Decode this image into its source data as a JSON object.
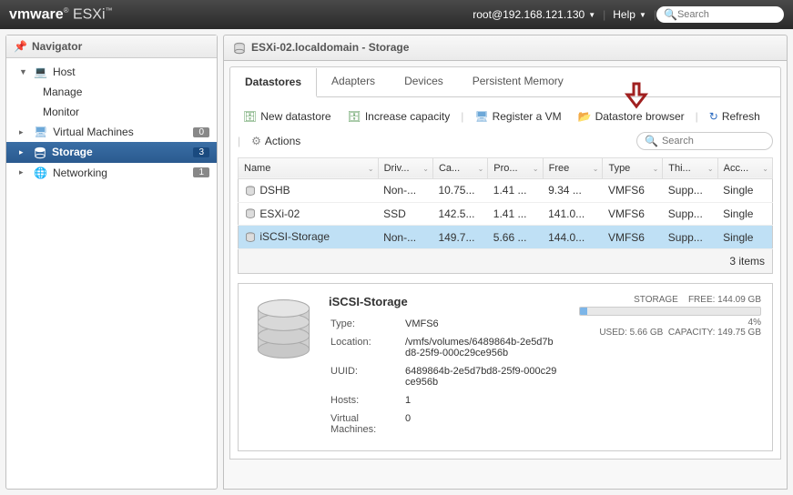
{
  "topbar": {
    "logo_vmware": "vmware",
    "logo_prod": "ESXi",
    "user": "root@192.168.121.130",
    "help": "Help",
    "search_placeholder": "Search"
  },
  "nav": {
    "title": "Navigator",
    "host": "Host",
    "manage": "Manage",
    "monitor": "Monitor",
    "vms": "Virtual Machines",
    "vms_badge": "0",
    "storage": "Storage",
    "storage_badge": "3",
    "networking": "Networking",
    "networking_badge": "1"
  },
  "header": {
    "title": "ESXi-02.localdomain - Storage"
  },
  "tabs": {
    "datastores": "Datastores",
    "adapters": "Adapters",
    "devices": "Devices",
    "pmem": "Persistent Memory"
  },
  "toolbar": {
    "new_ds": "New datastore",
    "increase": "Increase capacity",
    "register": "Register a VM",
    "browser": "Datastore browser",
    "refresh": "Refresh",
    "actions": "Actions",
    "search_placeholder": "Search"
  },
  "grid": {
    "headers": {
      "name": "Name",
      "drive": "Driv...",
      "capacity": "Ca...",
      "provisioned": "Pro...",
      "free": "Free",
      "type": "Type",
      "thin": "Thi...",
      "access": "Acc..."
    },
    "rows": [
      {
        "name": "DSHB",
        "drive": "Non-...",
        "capacity": "10.75...",
        "provisioned": "1.41 ...",
        "free": "9.34 ...",
        "type": "VMFS6",
        "thin": "Supp...",
        "access": "Single"
      },
      {
        "name": "ESXi-02",
        "drive": "SSD",
        "capacity": "142.5...",
        "provisioned": "1.41 ...",
        "free": "141.0...",
        "type": "VMFS6",
        "thin": "Supp...",
        "access": "Single"
      },
      {
        "name": "iSCSI-Storage",
        "drive": "Non-...",
        "capacity": "149.7...",
        "provisioned": "5.66 ...",
        "free": "144.0...",
        "type": "VMFS6",
        "thin": "Supp...",
        "access": "Single"
      }
    ],
    "footer": "3 items"
  },
  "detail": {
    "title": "iSCSI-Storage",
    "labels": {
      "type": "Type:",
      "location": "Location:",
      "uuid": "UUID:",
      "hosts": "Hosts:",
      "vms": "Virtual Machines:"
    },
    "values": {
      "type": "VMFS6",
      "location": "/vmfs/volumes/6489864b-2e5d7bd8-25f9-000c29ce956b",
      "uuid": "6489864b-2e5d7bd8-25f9-000c29ce956b",
      "hosts": "1",
      "vms": "0"
    },
    "storage": {
      "label": "STORAGE",
      "free": "FREE: 144.09 GB",
      "pct": "4%",
      "used": "USED: 5.66 GB",
      "capacity": "CAPACITY: 149.75 GB"
    }
  }
}
